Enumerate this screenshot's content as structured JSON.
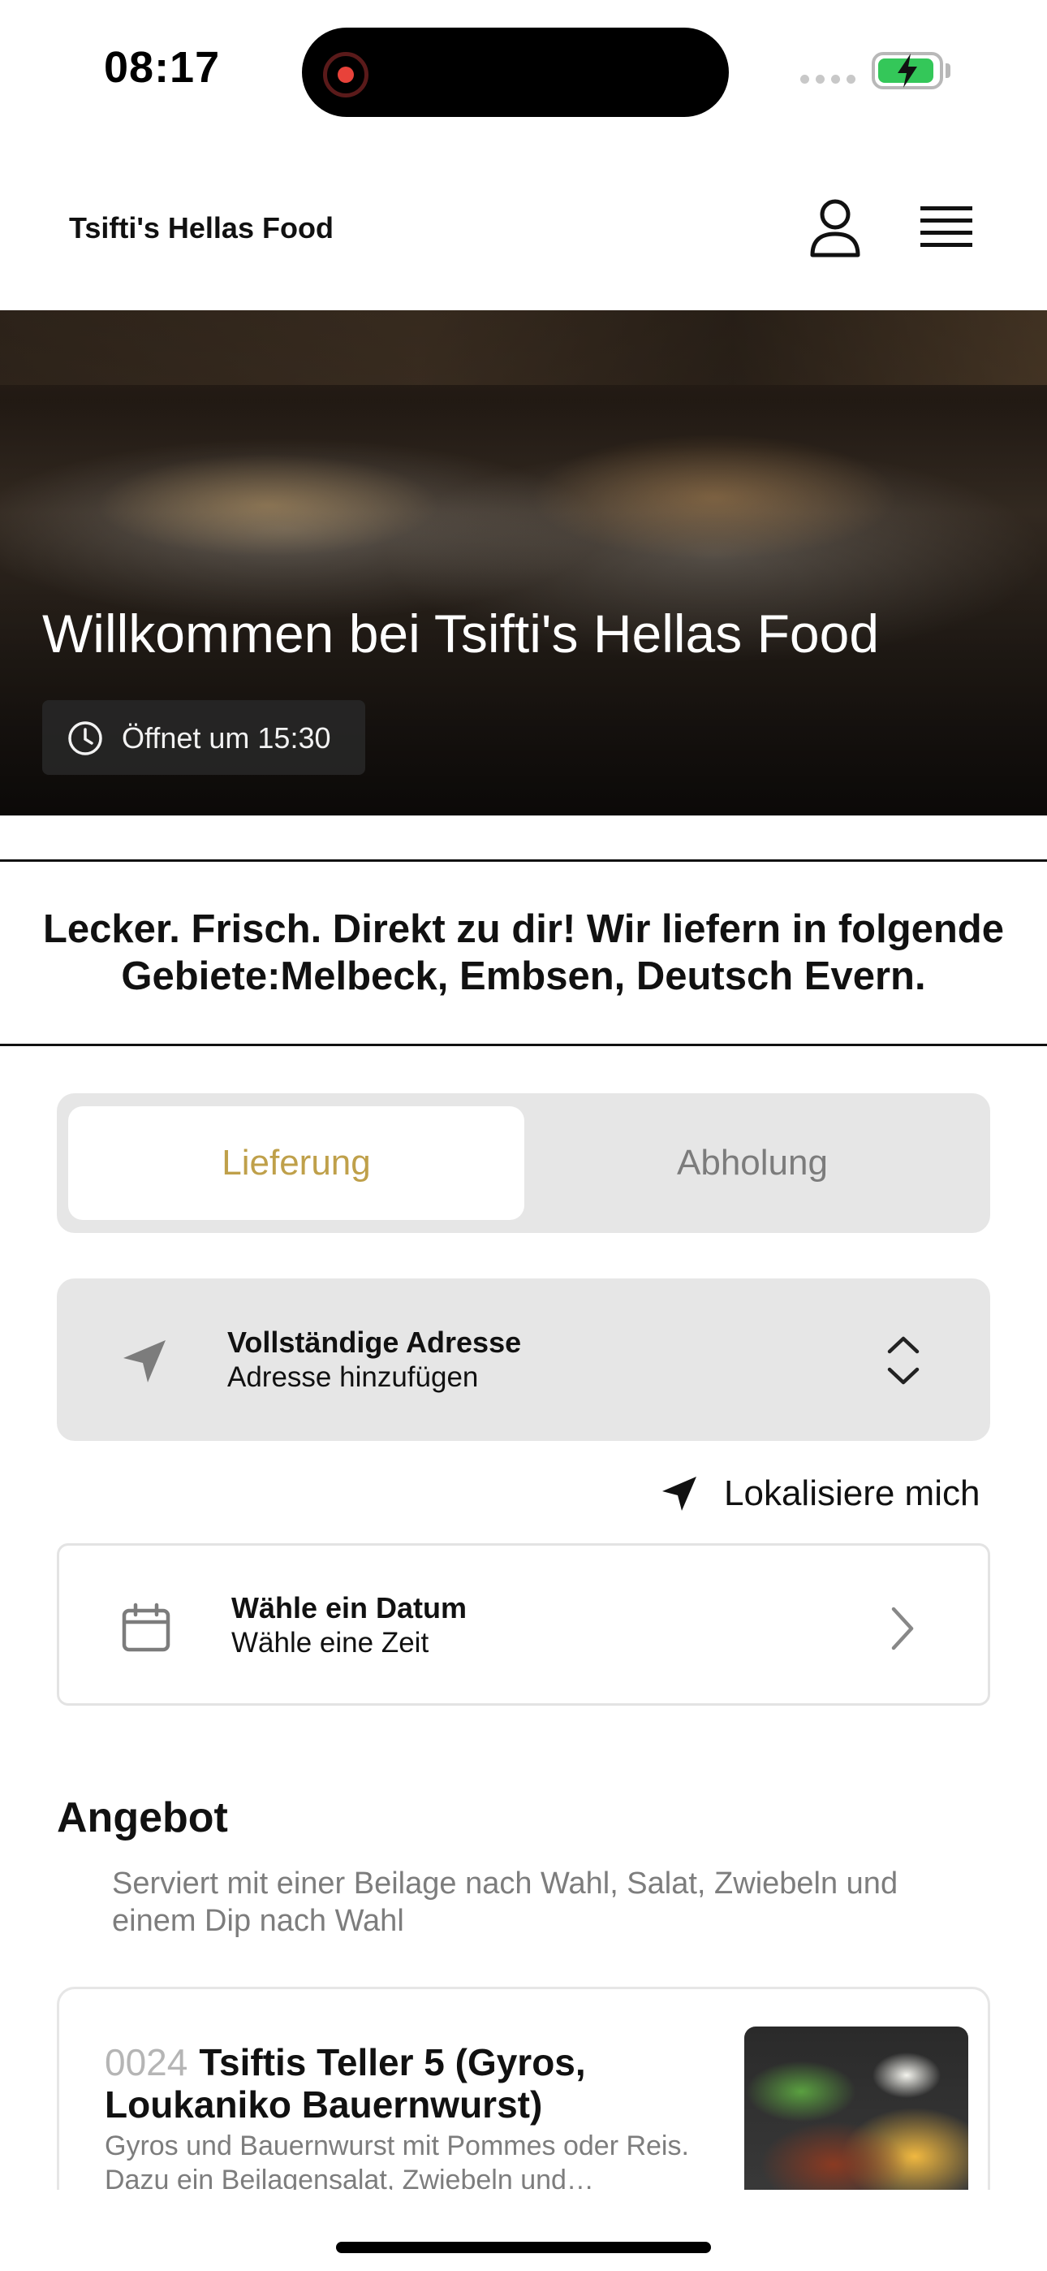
{
  "status_bar": {
    "time": "08:17",
    "battery_level": 0.85,
    "battery_color": "#34c759",
    "icons": [
      "recording-icon",
      "signal-icon",
      "battery-charging-icon"
    ]
  },
  "header": {
    "brand": "Tsifti's Hellas Food",
    "icons": [
      "user-icon",
      "menu-icon"
    ]
  },
  "hero": {
    "title": "Willkommen bei Tsifti's Hellas Food",
    "opening": "Öffnet um 15:30",
    "icon": "clock-icon"
  },
  "banner": {
    "text": "Lecker. Frisch. Direkt zu dir! Wir liefern in folgende Gebiete:Melbeck, Embsen, Deutsch Evern."
  },
  "order_mode": {
    "options": [
      "Lieferung",
      "Abholung"
    ],
    "selected": "Lieferung",
    "accent_color": "#bfa04a"
  },
  "address": {
    "title": "Vollständige Adresse",
    "subtitle": "Adresse hinzufügen",
    "icon": "navigation-arrow-icon"
  },
  "locate": {
    "label": "Lokalisiere mich",
    "icon": "navigation-arrow-icon"
  },
  "schedule": {
    "title": "Wähle ein Datum",
    "subtitle": "Wähle eine Zeit",
    "icon": "calendar-icon"
  },
  "section": {
    "title": "Angebot",
    "description": "Serviert mit einer Beilage nach Wahl, Salat, Zwiebeln und einem Dip nach Wahl"
  },
  "products": [
    {
      "code": "0024",
      "name": "Tsiftis Teller 5 (Gyros, Loukaniko Bauernwurst)",
      "description": "Gyros und Bauernwurst mit Pommes oder Reis. Dazu ein Beilagensalat, Zwiebeln und…"
    }
  ]
}
